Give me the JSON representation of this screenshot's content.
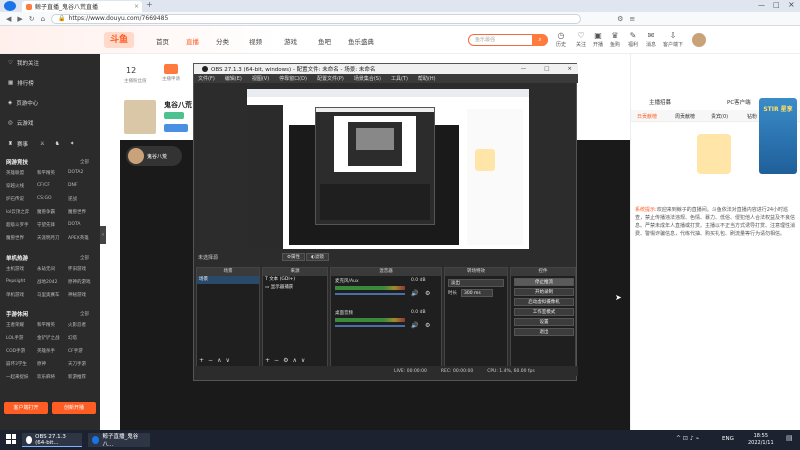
{
  "browser": {
    "tab_title": "鲸子直播_鬼谷八荒直播",
    "url": "https://www.douyu.com/7669485"
  },
  "site": {
    "nav": [
      "首页",
      "直播",
      "分类",
      "视频",
      "游戏",
      "鱼吧",
      "鱼乐盛典"
    ],
    "search_placeholder": "鱼乐最强",
    "header_icons": [
      {
        "icon": "history-icon",
        "label": "历史"
      },
      {
        "icon": "follow-icon",
        "label": "关注"
      },
      {
        "icon": "broadcast-icon",
        "label": "开播"
      },
      {
        "icon": "fans-icon",
        "label": "鱼购"
      },
      {
        "icon": "task-icon",
        "label": "福利"
      },
      {
        "icon": "message-icon",
        "label": "消息"
      },
      {
        "icon": "client-icon",
        "label": "客户端下"
      }
    ]
  },
  "sidebar": {
    "top": [
      {
        "icon": "heart-icon",
        "label": "我的关注"
      },
      {
        "icon": "rank-icon",
        "label": "排行榜"
      },
      {
        "icon": "shield-icon",
        "label": "页游中心"
      },
      {
        "icon": "game-icon",
        "label": "云游戏"
      }
    ],
    "events_label": "赛事",
    "sections": [
      {
        "title": "网游竞技",
        "more": "全部",
        "items": [
          "英雄联盟",
          "和平精英",
          "DOTA2",
          "穿越火线",
          "CF/CF",
          "DNF",
          "炉石传说",
          "CS:GO",
          "逆战",
          "lol云顶之弈",
          "魔兽争霸",
          "魔兽世界",
          "超级斗罗手",
          "守望先锋",
          "DOTA",
          "魔兽世界",
          "天涯明月刀",
          "APEX英雄"
        ]
      },
      {
        "title": "单机热游",
        "more": "全部",
        "items": [
          "主机游戏",
          "永劫无间",
          "怀旧游戏",
          "Pepsight",
          "战地2042",
          "原神的游戏",
          "单机游戏",
          "马里奥赛车",
          "神秘游戏"
        ]
      },
      {
        "title": "手游休闲",
        "more": "全部",
        "items": [
          "王者荣耀",
          "和平精英",
          "火影忍者",
          "LOL手游",
          "金铲铲之战",
          "幻塔",
          "COD手游",
          "英雄杀手",
          "CF手游",
          "崩坏3学生",
          "原神",
          "天刀手游",
          "一起来捉妖",
          "欢乐麻将",
          "新游推荐"
        ]
      }
    ],
    "footer_buttons": [
      "客户端打开",
      "创新开播"
    ]
  },
  "streamer": {
    "followers": "12",
    "followers_label": "主播粉丝值",
    "name": "鬼谷八荒",
    "badge": "鬼谷八荒",
    "gift_label": "主播申请"
  },
  "obs": {
    "title": "OBS 27.1.3 (64-bit, windows) - 配置文件: 未命名 - 场景: 未命名",
    "menu": [
      "文件(F)",
      "编辑(E)",
      "视图(V)",
      "停靠窗口(D)",
      "配置文件(P)",
      "场景集合(S)",
      "工具(T)",
      "帮助(H)"
    ],
    "no_source": "未选择源",
    "props_label": "属性",
    "filter_label": "滤镜",
    "docks": {
      "scenes": {
        "header": "场景",
        "items": [
          "场景"
        ]
      },
      "sources": {
        "header": "来源",
        "items": [
          "文本 (GDI+)",
          "显示器捕获"
        ]
      },
      "mixer": {
        "header": "混音器",
        "tracks": [
          {
            "name": "麦克风/Aux",
            "db": "0.0 dB"
          },
          {
            "name": "桌面音频",
            "db": "0.0 dB"
          }
        ]
      },
      "transitions": {
        "header": "转场特效",
        "type": "淡出",
        "duration_label": "时长",
        "duration": "300 ms"
      },
      "controls": {
        "header": "控件",
        "buttons": [
          "停止推流",
          "开始录制",
          "启动虚拟摄像机",
          "工作室模式",
          "设置",
          "退出"
        ]
      }
    },
    "status": {
      "live": "LIVE: 00:00:00",
      "rec": "REC: 00:00:00",
      "cpu": "CPU: 1.4%, 60.00 fps"
    }
  },
  "right_panel": {
    "tabs": [
      "主播招募",
      "PC客户端"
    ],
    "list_tabs": [
      "日贡献榜",
      "周贡献榜",
      "贵宾(0)",
      "钻粉"
    ],
    "notice_label": "系统提示:",
    "notice": "欢迎来到鲸子的直播间。斗鱼依法对直播内容进行24小时巡查，禁止传播违法违规、色情、暴力、低俗、侵犯他人合法权益及不良信息。严禁未成年人直播或打赏。主播以不正当方式诱导打赏、注意理性消费、警惕诈骗信息，代练代抽、购买礼包、刷流量等行为请勿相信。",
    "promo": "STIR 星享"
  },
  "taskbar": {
    "items": [
      "OBS 27.1.3 (64-bit...",
      "鲸子直播_鬼谷八..."
    ],
    "lang": "ENG",
    "time": "18:55",
    "date": "2022/1/11"
  },
  "colors": {
    "accent": "#ff5d23",
    "sidebar_bg": "#2b2b2b",
    "obs_bg": "#2c2c2c",
    "taskbar": "#1c2230"
  }
}
